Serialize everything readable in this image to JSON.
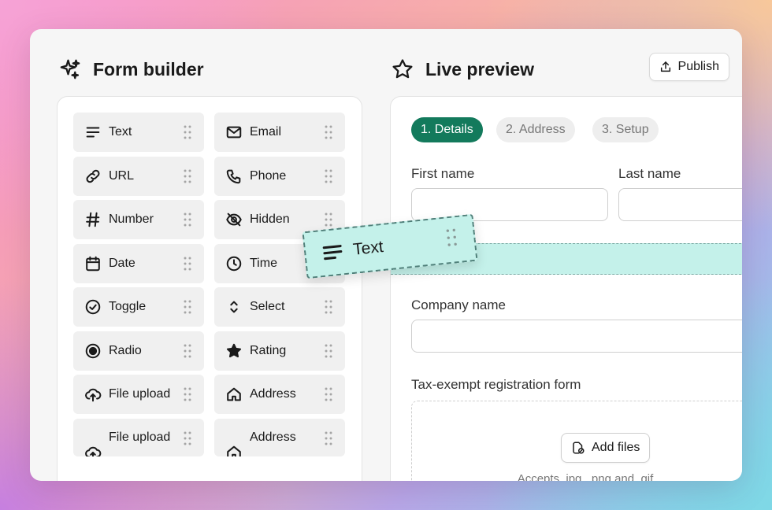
{
  "builder": {
    "title": "Form builder",
    "title_icon": "sparkles-icon"
  },
  "preview": {
    "title": "Live preview",
    "title_icon": "star-icon"
  },
  "publish": {
    "label": "Publish",
    "icon": "share-upload-icon"
  },
  "fields": [
    {
      "label": "Text",
      "icon": "text-lines-icon"
    },
    {
      "label": "Email",
      "icon": "envelope-icon"
    },
    {
      "label": "URL",
      "icon": "link-icon"
    },
    {
      "label": "Phone",
      "icon": "phone-icon"
    },
    {
      "label": "Number",
      "icon": "hash-icon"
    },
    {
      "label": "Hidden",
      "icon": "eye-off-icon"
    },
    {
      "label": "Date",
      "icon": "calendar-icon"
    },
    {
      "label": "Time",
      "icon": "clock-icon"
    },
    {
      "label": "Toggle",
      "icon": "check-circle-icon"
    },
    {
      "label": "Select",
      "icon": "chevron-up-down-icon"
    },
    {
      "label": "Radio",
      "icon": "radio-icon"
    },
    {
      "label": "Rating",
      "icon": "star-filled-icon"
    },
    {
      "label": "File upload",
      "icon": "cloud-upload-icon"
    },
    {
      "label": "Address",
      "icon": "home-icon"
    },
    {
      "label": "File upload",
      "icon": "cloud-upload-icon"
    },
    {
      "label": "Address",
      "icon": "home-icon"
    }
  ],
  "steps": [
    {
      "label": "1. Details",
      "active": true
    },
    {
      "label": "2. Address",
      "active": false
    },
    {
      "label": "3. Setup",
      "active": false
    }
  ],
  "form": {
    "first_name_label": "First name",
    "last_name_label": "Last name",
    "company_label": "Company name",
    "upload_label": "Tax-exempt registration form",
    "add_files": "Add files",
    "accepts": "Accepts .jpg, .png and .gif"
  },
  "drag_chip": {
    "label": "Text",
    "icon": "text-lines-icon"
  },
  "colors": {
    "accent": "#137a5c",
    "drag_fill": "#c4f1ea"
  }
}
